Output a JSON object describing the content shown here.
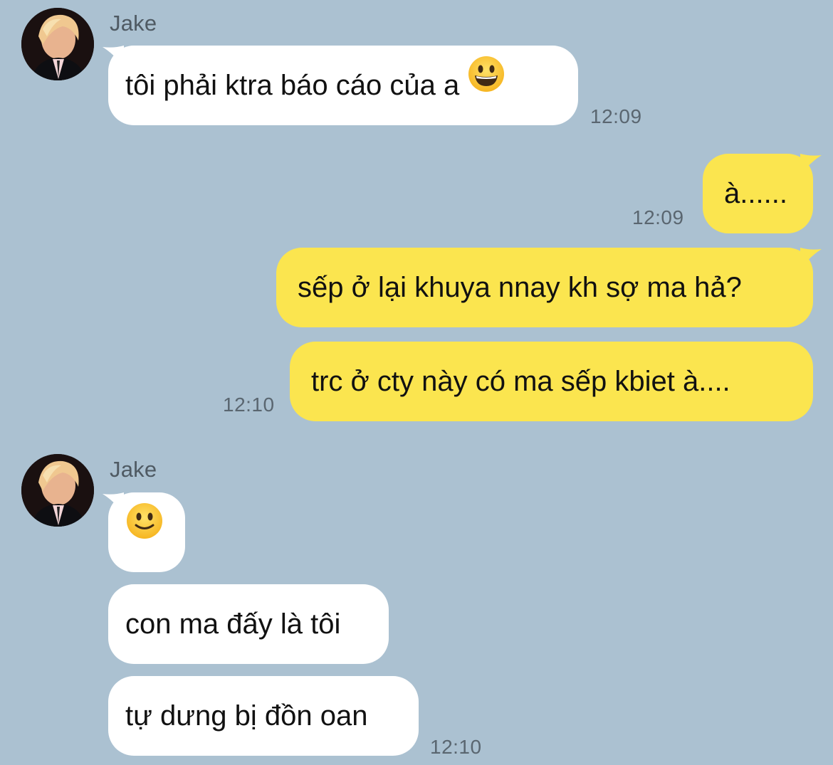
{
  "contact": {
    "name": "Jake",
    "avatar_icon": "profile-photo-icon"
  },
  "colors": {
    "background": "#abc1d1",
    "incoming_bubble": "#ffffff",
    "outgoing_bubble": "#fbe54f",
    "timestamp": "#5a6670"
  },
  "messages": [
    {
      "direction": "in",
      "text": "tôi phải ktra báo cáo của a",
      "emoji": "grinning-face-icon",
      "time": "12:09"
    },
    {
      "direction": "out",
      "text": "à......",
      "time": "12:09"
    },
    {
      "direction": "out",
      "text": "sếp ở lại khuya nnay kh sợ ma hả?"
    },
    {
      "direction": "out",
      "text": "trc ở cty này có ma sếp kbiet à....",
      "time": "12:10"
    },
    {
      "direction": "in",
      "text": "",
      "emoji": "slightly-smiling-face-icon"
    },
    {
      "direction": "in",
      "text": "con ma đấy là tôi"
    },
    {
      "direction": "in",
      "text": "tự dưng bị đồn oan",
      "time": "12:10"
    }
  ]
}
